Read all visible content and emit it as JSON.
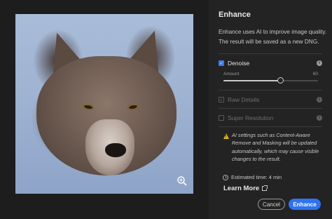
{
  "preview": {
    "zoom_icon": "magnify-icon"
  },
  "panel": {
    "title": "Enhance",
    "description": "Enhance uses AI to improve image quality. The result will be saved as a new DNG.",
    "options": [
      {
        "label": "Denoise",
        "checked": true,
        "enabled": true,
        "icon": "info-icon"
      },
      {
        "label": "Raw Details",
        "checked": true,
        "enabled": false,
        "icon": "info-icon"
      },
      {
        "label": "Super Resolution",
        "checked": false,
        "enabled": false,
        "icon": "info-icon"
      }
    ],
    "slider": {
      "label": "Amount",
      "value": 60,
      "max": 100
    },
    "warning": "AI settings such as Content-Aware Remove and Masking will be updated automatically, which may cause visible changes to the result.",
    "estimate": "Estimated time: 4 min",
    "learn_more": "Learn More",
    "cancel_label": "Cancel",
    "enhance_label": "Enhance"
  },
  "colors": {
    "accent": "#2f73f0",
    "warning": "#e0b020",
    "background": "#232323"
  }
}
